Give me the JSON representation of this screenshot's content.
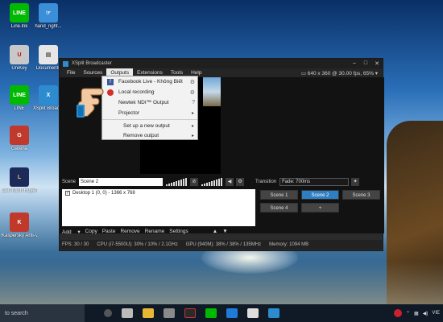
{
  "desktop": {
    "icons": [
      {
        "label": "Line.lnk",
        "img_text": "LINE",
        "color": "#00b900"
      },
      {
        "label": "hand_right...",
        "img_text": "☞",
        "color": "#3a8fd8"
      },
      {
        "label": "UniKey",
        "img_text": "U",
        "color": "#c8c8c8"
      },
      {
        "label": "Documents",
        "img_text": "▤",
        "color": "#e6e6e6"
      },
      {
        "label": "LINE",
        "img_text": "LINE",
        "color": "#00b900"
      },
      {
        "label": "XSplit Broad...",
        "img_text": "X",
        "color": "#2d8ccf"
      },
      {
        "label": "Garena",
        "img_text": "G",
        "color": "#c0392b"
      },
      {
        "label": "Liên Minh Huyền Thoại",
        "img_text": "L",
        "color": "#1c2a5a"
      },
      {
        "label": "Kaspersky Anti-Virus",
        "img_text": "K",
        "color": "#c0392b"
      }
    ]
  },
  "window": {
    "title": "XSplit Broadcaster",
    "resolution": "640 x 360 @ 30.00 fps, 65%",
    "menu": [
      "File",
      "Sources",
      "Outputs",
      "Extensions",
      "Tools",
      "Help"
    ],
    "active_menu_index": 2
  },
  "outputs_menu": {
    "facebook": "Facebook Live - Không Biết",
    "local": "Local recording",
    "newtek": "Newtek NDI™ Output",
    "projector": "Projector",
    "setup": "Set up a new output",
    "remove": "Remove output"
  },
  "scene_bar": {
    "scene_label": "Scene",
    "scene_value": "Scene 2",
    "transition_label": "Transition",
    "transition_value": "Fade: 700ms"
  },
  "sources": {
    "items": [
      "Desktop 1 (0, 0) - 1366 x 768"
    ],
    "tools": [
      "Add",
      "Copy",
      "Paste",
      "Remove",
      "Rename",
      "Settings"
    ]
  },
  "scenes": {
    "buttons": [
      "Scene 1",
      "Scene 2",
      "Scene 3",
      "Scene 4",
      "+"
    ],
    "active_index": 1
  },
  "status": {
    "fps": "FPS:  30 / 30",
    "cpu": "CPU (i7-5500U):  30% / 10% / 2.1GHz",
    "gpu": "GPU (940M):  38% / 38% / 135MHz",
    "memory": "Memory:  1094 MB"
  },
  "taskbar": {
    "search_text": "to search",
    "lang": "VIE"
  }
}
